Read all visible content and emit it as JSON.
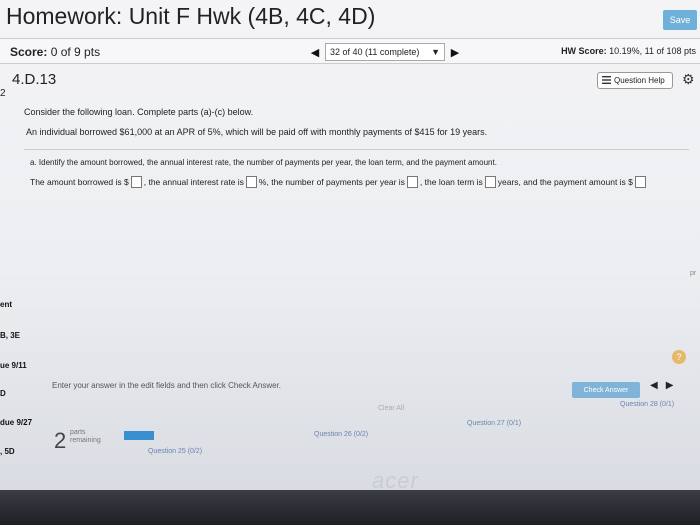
{
  "header": {
    "title": "Homework: Unit F Hwk (4B, 4C, 4D)",
    "save_label": "Save"
  },
  "score_bar": {
    "score_label": "Score:",
    "score_value": "0 of 9 pts",
    "prev_arrow": "◀",
    "next_arrow": "▶",
    "question_selector": "32 of 40 (11 complete)",
    "selector_caret": "▼",
    "hw_score_label": "HW Score:",
    "hw_score_value": "10.19%, 11 of 108 pts"
  },
  "question": {
    "id": "4.D.13",
    "help_label": "Question Help",
    "side_number": "2",
    "intro": "Consider the following loan. Complete parts (a)-(c) below.",
    "loan_text": "An individual borrowed $61,000 at an APR of 5%, which will be paid off with monthly payments of $415 for 19 years.",
    "part_a": "a. Identify the amount borrowed, the annual interest rate, the number of payments per year, the loan term, and the payment amount.",
    "answer": {
      "t1": "The amount borrowed is $",
      "t2": ", the annual interest rate is",
      "t3": "%, the number of payments per year is",
      "t4": ", the loan term is",
      "t5": "years, and the payment amount is $"
    }
  },
  "sidebar_fragments": [
    "ent",
    "B, 3E",
    "ue 9/11",
    "D",
    "due 9/27",
    ", 5D"
  ],
  "footer": {
    "instructions": "Enter your answer in the edit fields and then click Check Answer.",
    "clear_all": "Clear All",
    "check_answer": "Check Answer",
    "parts_count": "2",
    "parts_label_1": "parts",
    "parts_label_2": "remaining",
    "pager_prev": "◀",
    "pager_next": "▶",
    "info_icon": "?",
    "question_tabs": [
      "Question 25 (0/2)",
      "Question 26 (0/2)",
      "Question 27 (0/1)",
      "Question 28 (0/1)"
    ],
    "corner_text": "pr"
  },
  "brand": "acer"
}
